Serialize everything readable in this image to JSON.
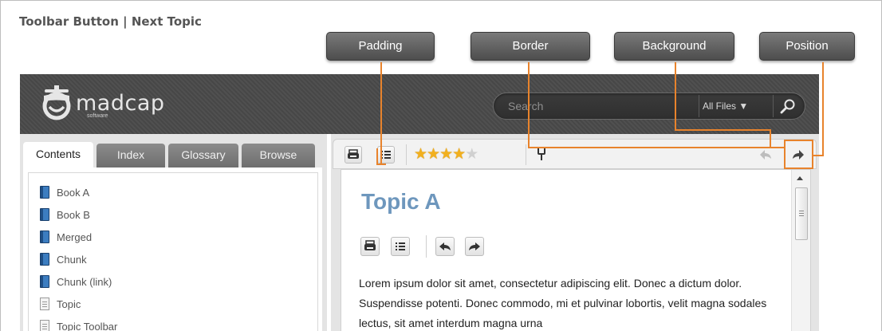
{
  "heading": "Toolbar Button  |  Next Topic",
  "callouts": {
    "padding": "Padding",
    "border": "Border",
    "background": "Background",
    "position": "Position"
  },
  "accent_color": "#e8832c",
  "header": {
    "logo_text": "madcap",
    "logo_sub": "software",
    "search_placeholder": "Search",
    "filter": "All Files ▼",
    "search_icon": "magnifier-icon"
  },
  "nav": {
    "tabs": [
      "Contents",
      "Index",
      "Glossary",
      "Browse"
    ],
    "items": [
      {
        "label": "Book A",
        "icon": "book-icon"
      },
      {
        "label": "Book B",
        "icon": "book-icon"
      },
      {
        "label": "Merged",
        "icon": "book-icon"
      },
      {
        "label": "Chunk",
        "icon": "book-icon"
      },
      {
        "label": "Chunk (link)",
        "icon": "book-icon"
      },
      {
        "label": "Topic",
        "icon": "page-icon"
      },
      {
        "label": "Topic Toolbar",
        "icon": "page-icon"
      }
    ]
  },
  "toolbar": {
    "buttons": [
      "print-icon",
      "toc-icon",
      "rating-stars",
      "remove-highlight-icon",
      "previous-topic-icon",
      "next-topic-icon"
    ],
    "rating": 4,
    "rating_max": 5
  },
  "topic": {
    "title": "Topic A",
    "body": "Lorem ipsum dolor sit amet, consectetur adipiscing elit. Donec a dictum dolor. Suspendisse potenti. Donec commodo, mi et pulvinar lobortis, velit magna sodales lectus, sit amet interdum magna urna"
  }
}
